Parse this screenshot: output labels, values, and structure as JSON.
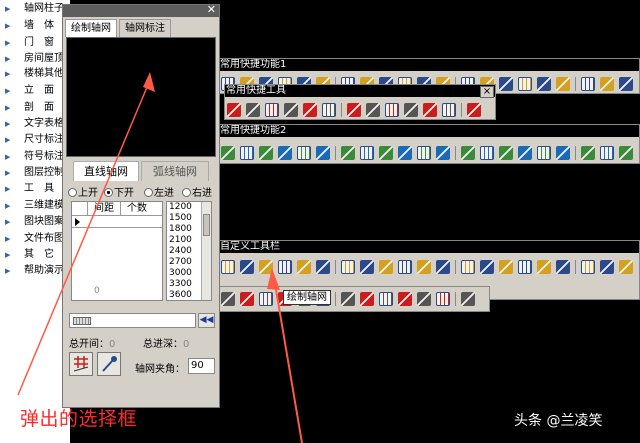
{
  "side_menu": {
    "items": [
      {
        "label": "轴网柱子"
      },
      {
        "label": "墙　体"
      },
      {
        "label": "门　窗"
      },
      {
        "label": "房间屋顶"
      },
      {
        "label": "楼梯其他"
      },
      {
        "label": "立　面"
      },
      {
        "label": "剖　面"
      },
      {
        "label": "文字表格"
      },
      {
        "label": "尺寸标注"
      },
      {
        "label": "符号标注"
      },
      {
        "label": "图层控制"
      },
      {
        "label": "工　具"
      },
      {
        "label": "三维建模"
      },
      {
        "label": "图块图案"
      },
      {
        "label": "文件布图"
      },
      {
        "label": "其　它"
      },
      {
        "label": "帮助演示"
      }
    ]
  },
  "dialog": {
    "close_glyph": "✕",
    "tabs": [
      {
        "label": "绘制轴网"
      },
      {
        "label": "轴网标注"
      }
    ],
    "subtabs": [
      {
        "label": "直线轴网"
      },
      {
        "label": "弧线轴网"
      }
    ],
    "radios": [
      {
        "label": "上开",
        "selected": false
      },
      {
        "label": "下开",
        "selected": true
      },
      {
        "label": "左进",
        "selected": false
      },
      {
        "label": "右进",
        "selected": false
      }
    ],
    "grid": {
      "headers": [
        "间距",
        "个数"
      ],
      "footer": "0"
    },
    "spacing_list": [
      "1200",
      "1500",
      "1800",
      "2100",
      "2400",
      "2700",
      "3000",
      "3300",
      "3600"
    ],
    "scroll_button": "◀◀",
    "total_open_label": "总开间：",
    "total_open_value": "0",
    "total_depth_label": "总进深：",
    "total_depth_value": "0",
    "angle_label": "轴网夹角：",
    "angle_value": "90"
  },
  "toolbars": {
    "t1_title": "常用快捷功能1",
    "t2_title": "常用快捷工具",
    "t3_title": "常用快捷功能2",
    "t4_title": "自定义工具栏",
    "close_glyph": "×"
  },
  "tooltip": "绘制轴网",
  "annotation": "弹出的选择框",
  "watermark": "头条 @兰凌笑",
  "colors": {
    "annotation": "#ff2a2a",
    "arrow": "#ff5a45",
    "icon_red": "#c81e1e",
    "icon_blue": "#2a4a8a"
  }
}
